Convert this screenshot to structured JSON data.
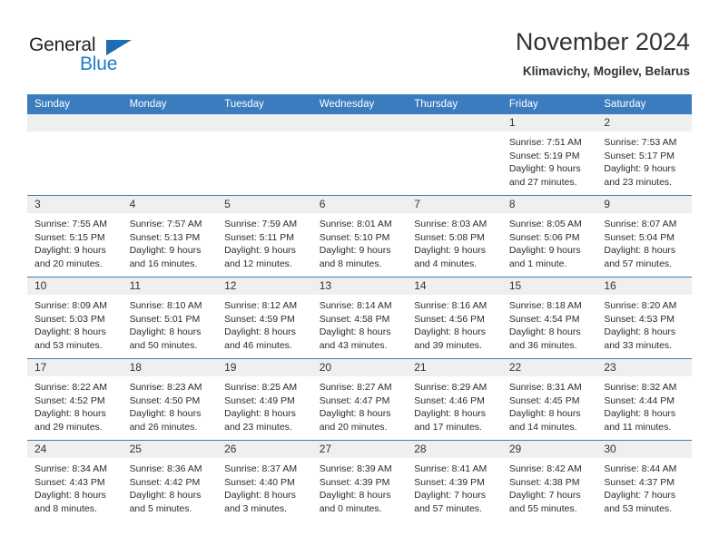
{
  "brand": {
    "name_part1": "General",
    "name_part2": "Blue",
    "logo_icon": "triangle-icon",
    "accent_color": "#1c6eb4"
  },
  "header": {
    "title": "November 2024",
    "location": "Klimavichy, Mogilev, Belarus"
  },
  "calendar": {
    "header_bg_color": "#3a7cbe",
    "day_band_color": "#efefef",
    "weekdays": [
      "Sunday",
      "Monday",
      "Tuesday",
      "Wednesday",
      "Thursday",
      "Friday",
      "Saturday"
    ],
    "weeks": [
      [
        {
          "day": "",
          "sunrise": "",
          "sunset": "",
          "daylight_line1": "",
          "daylight_line2": "",
          "empty": true
        },
        {
          "day": "",
          "sunrise": "",
          "sunset": "",
          "daylight_line1": "",
          "daylight_line2": "",
          "empty": true
        },
        {
          "day": "",
          "sunrise": "",
          "sunset": "",
          "daylight_line1": "",
          "daylight_line2": "",
          "empty": true
        },
        {
          "day": "",
          "sunrise": "",
          "sunset": "",
          "daylight_line1": "",
          "daylight_line2": "",
          "empty": true
        },
        {
          "day": "",
          "sunrise": "",
          "sunset": "",
          "daylight_line1": "",
          "daylight_line2": "",
          "empty": true
        },
        {
          "day": "1",
          "sunrise": "Sunrise: 7:51 AM",
          "sunset": "Sunset: 5:19 PM",
          "daylight_line1": "Daylight: 9 hours",
          "daylight_line2": "and 27 minutes.",
          "empty": false
        },
        {
          "day": "2",
          "sunrise": "Sunrise: 7:53 AM",
          "sunset": "Sunset: 5:17 PM",
          "daylight_line1": "Daylight: 9 hours",
          "daylight_line2": "and 23 minutes.",
          "empty": false
        }
      ],
      [
        {
          "day": "3",
          "sunrise": "Sunrise: 7:55 AM",
          "sunset": "Sunset: 5:15 PM",
          "daylight_line1": "Daylight: 9 hours",
          "daylight_line2": "and 20 minutes.",
          "empty": false
        },
        {
          "day": "4",
          "sunrise": "Sunrise: 7:57 AM",
          "sunset": "Sunset: 5:13 PM",
          "daylight_line1": "Daylight: 9 hours",
          "daylight_line2": "and 16 minutes.",
          "empty": false
        },
        {
          "day": "5",
          "sunrise": "Sunrise: 7:59 AM",
          "sunset": "Sunset: 5:11 PM",
          "daylight_line1": "Daylight: 9 hours",
          "daylight_line2": "and 12 minutes.",
          "empty": false
        },
        {
          "day": "6",
          "sunrise": "Sunrise: 8:01 AM",
          "sunset": "Sunset: 5:10 PM",
          "daylight_line1": "Daylight: 9 hours",
          "daylight_line2": "and 8 minutes.",
          "empty": false
        },
        {
          "day": "7",
          "sunrise": "Sunrise: 8:03 AM",
          "sunset": "Sunset: 5:08 PM",
          "daylight_line1": "Daylight: 9 hours",
          "daylight_line2": "and 4 minutes.",
          "empty": false
        },
        {
          "day": "8",
          "sunrise": "Sunrise: 8:05 AM",
          "sunset": "Sunset: 5:06 PM",
          "daylight_line1": "Daylight: 9 hours",
          "daylight_line2": "and 1 minute.",
          "empty": false
        },
        {
          "day": "9",
          "sunrise": "Sunrise: 8:07 AM",
          "sunset": "Sunset: 5:04 PM",
          "daylight_line1": "Daylight: 8 hours",
          "daylight_line2": "and 57 minutes.",
          "empty": false
        }
      ],
      [
        {
          "day": "10",
          "sunrise": "Sunrise: 8:09 AM",
          "sunset": "Sunset: 5:03 PM",
          "daylight_line1": "Daylight: 8 hours",
          "daylight_line2": "and 53 minutes.",
          "empty": false
        },
        {
          "day": "11",
          "sunrise": "Sunrise: 8:10 AM",
          "sunset": "Sunset: 5:01 PM",
          "daylight_line1": "Daylight: 8 hours",
          "daylight_line2": "and 50 minutes.",
          "empty": false
        },
        {
          "day": "12",
          "sunrise": "Sunrise: 8:12 AM",
          "sunset": "Sunset: 4:59 PM",
          "daylight_line1": "Daylight: 8 hours",
          "daylight_line2": "and 46 minutes.",
          "empty": false
        },
        {
          "day": "13",
          "sunrise": "Sunrise: 8:14 AM",
          "sunset": "Sunset: 4:58 PM",
          "daylight_line1": "Daylight: 8 hours",
          "daylight_line2": "and 43 minutes.",
          "empty": false
        },
        {
          "day": "14",
          "sunrise": "Sunrise: 8:16 AM",
          "sunset": "Sunset: 4:56 PM",
          "daylight_line1": "Daylight: 8 hours",
          "daylight_line2": "and 39 minutes.",
          "empty": false
        },
        {
          "day": "15",
          "sunrise": "Sunrise: 8:18 AM",
          "sunset": "Sunset: 4:54 PM",
          "daylight_line1": "Daylight: 8 hours",
          "daylight_line2": "and 36 minutes.",
          "empty": false
        },
        {
          "day": "16",
          "sunrise": "Sunrise: 8:20 AM",
          "sunset": "Sunset: 4:53 PM",
          "daylight_line1": "Daylight: 8 hours",
          "daylight_line2": "and 33 minutes.",
          "empty": false
        }
      ],
      [
        {
          "day": "17",
          "sunrise": "Sunrise: 8:22 AM",
          "sunset": "Sunset: 4:52 PM",
          "daylight_line1": "Daylight: 8 hours",
          "daylight_line2": "and 29 minutes.",
          "empty": false
        },
        {
          "day": "18",
          "sunrise": "Sunrise: 8:23 AM",
          "sunset": "Sunset: 4:50 PM",
          "daylight_line1": "Daylight: 8 hours",
          "daylight_line2": "and 26 minutes.",
          "empty": false
        },
        {
          "day": "19",
          "sunrise": "Sunrise: 8:25 AM",
          "sunset": "Sunset: 4:49 PM",
          "daylight_line1": "Daylight: 8 hours",
          "daylight_line2": "and 23 minutes.",
          "empty": false
        },
        {
          "day": "20",
          "sunrise": "Sunrise: 8:27 AM",
          "sunset": "Sunset: 4:47 PM",
          "daylight_line1": "Daylight: 8 hours",
          "daylight_line2": "and 20 minutes.",
          "empty": false
        },
        {
          "day": "21",
          "sunrise": "Sunrise: 8:29 AM",
          "sunset": "Sunset: 4:46 PM",
          "daylight_line1": "Daylight: 8 hours",
          "daylight_line2": "and 17 minutes.",
          "empty": false
        },
        {
          "day": "22",
          "sunrise": "Sunrise: 8:31 AM",
          "sunset": "Sunset: 4:45 PM",
          "daylight_line1": "Daylight: 8 hours",
          "daylight_line2": "and 14 minutes.",
          "empty": false
        },
        {
          "day": "23",
          "sunrise": "Sunrise: 8:32 AM",
          "sunset": "Sunset: 4:44 PM",
          "daylight_line1": "Daylight: 8 hours",
          "daylight_line2": "and 11 minutes.",
          "empty": false
        }
      ],
      [
        {
          "day": "24",
          "sunrise": "Sunrise: 8:34 AM",
          "sunset": "Sunset: 4:43 PM",
          "daylight_line1": "Daylight: 8 hours",
          "daylight_line2": "and 8 minutes.",
          "empty": false
        },
        {
          "day": "25",
          "sunrise": "Sunrise: 8:36 AM",
          "sunset": "Sunset: 4:42 PM",
          "daylight_line1": "Daylight: 8 hours",
          "daylight_line2": "and 5 minutes.",
          "empty": false
        },
        {
          "day": "26",
          "sunrise": "Sunrise: 8:37 AM",
          "sunset": "Sunset: 4:40 PM",
          "daylight_line1": "Daylight: 8 hours",
          "daylight_line2": "and 3 minutes.",
          "empty": false
        },
        {
          "day": "27",
          "sunrise": "Sunrise: 8:39 AM",
          "sunset": "Sunset: 4:39 PM",
          "daylight_line1": "Daylight: 8 hours",
          "daylight_line2": "and 0 minutes.",
          "empty": false
        },
        {
          "day": "28",
          "sunrise": "Sunrise: 8:41 AM",
          "sunset": "Sunset: 4:39 PM",
          "daylight_line1": "Daylight: 7 hours",
          "daylight_line2": "and 57 minutes.",
          "empty": false
        },
        {
          "day": "29",
          "sunrise": "Sunrise: 8:42 AM",
          "sunset": "Sunset: 4:38 PM",
          "daylight_line1": "Daylight: 7 hours",
          "daylight_line2": "and 55 minutes.",
          "empty": false
        },
        {
          "day": "30",
          "sunrise": "Sunrise: 8:44 AM",
          "sunset": "Sunset: 4:37 PM",
          "daylight_line1": "Daylight: 7 hours",
          "daylight_line2": "and 53 minutes.",
          "empty": false
        }
      ]
    ]
  }
}
